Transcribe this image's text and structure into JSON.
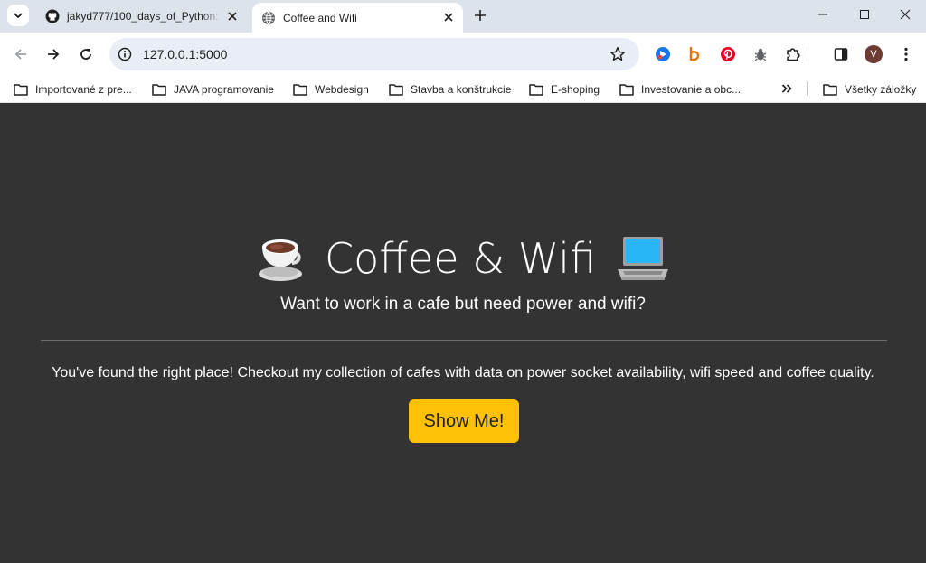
{
  "browser": {
    "tabs": [
      {
        "title": "jakyd777/100_days_of_Python: ",
        "favicon": "github-icon",
        "active": false
      },
      {
        "title": "Coffee and Wifi",
        "favicon": "globe-icon",
        "active": true
      }
    ],
    "address": {
      "url": "127.0.0.1:5000"
    },
    "profile_initial": "V",
    "extensions": [
      "screencast-extension-icon",
      "b-extension-icon",
      "pinterest-extension-icon",
      "bug-extension-icon",
      "puzzle-icon",
      "side-panel-icon"
    ]
  },
  "bookmarks": {
    "items": [
      {
        "label": "Importované z pre..."
      },
      {
        "label": "JAVA programovanie"
      },
      {
        "label": "Webdesign"
      },
      {
        "label": "Stavba a konštrukcie"
      },
      {
        "label": "E-shoping"
      },
      {
        "label": "Investovanie a obc..."
      }
    ],
    "all_bookmarks": "Všetky záložky"
  },
  "page": {
    "title": "Coffee & Wifi",
    "subtitle": "Want to work in a cafe but need power and wifi?",
    "lead": "You've found the right place! Checkout my collection of cafes with data on power socket availability, wifi speed and coffee quality.",
    "button_label": "Show Me!",
    "background": "#333333",
    "button_color": "#ffc107"
  }
}
